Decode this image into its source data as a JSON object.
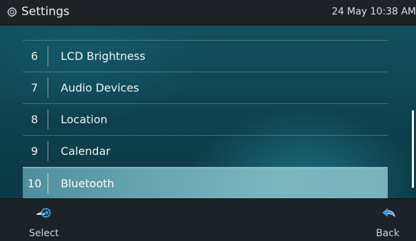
{
  "header": {
    "title": "Settings",
    "datetime": "24 May 10:38 AM"
  },
  "menu": {
    "items": [
      {
        "number": "6",
        "label": "LCD Brightness",
        "selected": false
      },
      {
        "number": "7",
        "label": "Audio Devices",
        "selected": false
      },
      {
        "number": "8",
        "label": "Location",
        "selected": false
      },
      {
        "number": "9",
        "label": "Calendar",
        "selected": false
      },
      {
        "number": "10",
        "label": "Bluetooth",
        "selected": true
      }
    ]
  },
  "softkeys": {
    "select_label": "Select",
    "back_label": "Back"
  },
  "colors": {
    "accent": "#3a9ad9",
    "selection": "#6aa9b4",
    "background": "#0f4755"
  },
  "icons": {
    "header": "gear-icon",
    "select": "select-arrow-icon",
    "back": "back-arrow-icon"
  }
}
